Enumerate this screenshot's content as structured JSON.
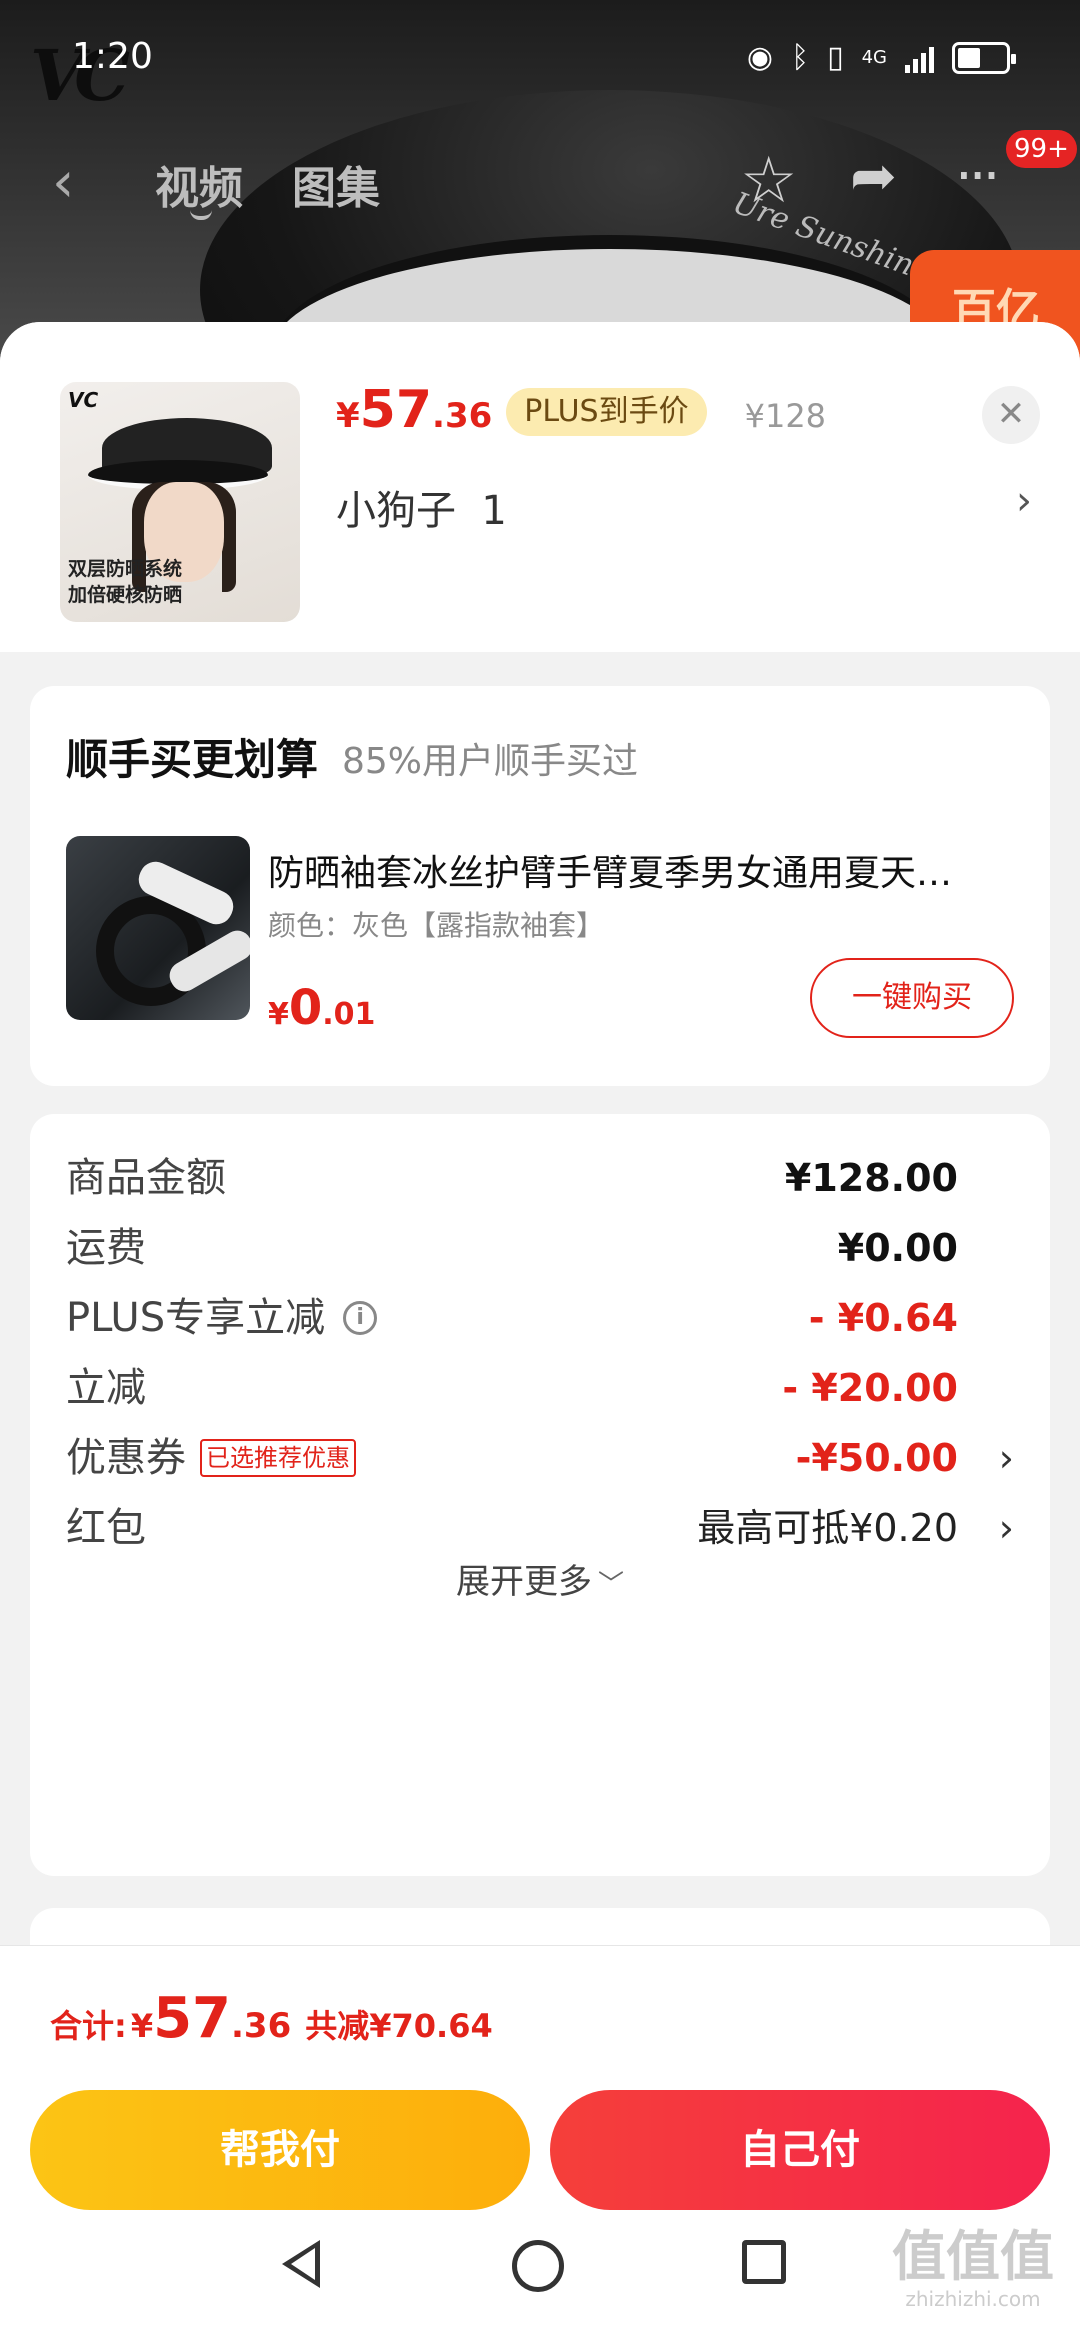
{
  "status_bar": {
    "time": "1:20",
    "network": "4G"
  },
  "background_page": {
    "tabs": [
      "视频",
      "图集"
    ],
    "badge": "99+",
    "visor_text": "Ure Sunshine",
    "brand_logo": "VC"
  },
  "product": {
    "currency": "¥",
    "price_int": "57",
    "price_dec": ".36",
    "plus_label": "PLUS到手价",
    "original_price": "¥128",
    "variant": "小狗子  1",
    "thumb_logo": "VC",
    "thumb_caption_1": "双层防晒系统",
    "thumb_caption_2": "加倍硬核防晒"
  },
  "cross_sell": {
    "title": "顺手买更划算",
    "subtitle": "85%用户顺手买过",
    "item_name": "防晒袖套冰丝护臂手臂夏季男女通用夏天…",
    "item_spec": "颜色：灰色【露指款袖套】",
    "price_currency": "¥",
    "price_int": "0",
    "price_dec": ".01",
    "buy_label": "一键购买"
  },
  "breakdown": {
    "rows": [
      {
        "label": "商品金额",
        "value": "¥128.00"
      },
      {
        "label": "运费",
        "value": "¥0.00"
      },
      {
        "label": "PLUS专享立减",
        "value": "- ¥0.64"
      },
      {
        "label": "立减",
        "value": "- ¥20.00"
      },
      {
        "label": "优惠券",
        "tag": "已选推荐优惠",
        "value": "-¥50.00"
      },
      {
        "label": "红包",
        "value": "最高可抵¥0.20"
      }
    ],
    "expand_label": "展开更多"
  },
  "footer": {
    "total_label": "合计:",
    "total_currency": "¥",
    "total_int": "57",
    "total_dec": ".36",
    "saved": "共减¥70.64",
    "help_pay": "帮我付",
    "self_pay": "自己付"
  },
  "watermark": {
    "mark": "值值值",
    "site": "zhizhizhi.com"
  },
  "colors": {
    "accent_red": "#e2231a",
    "plus_pill": "#fcebb0",
    "pay_yellow": "#fcc415",
    "pay_red": "#f53f3a"
  }
}
